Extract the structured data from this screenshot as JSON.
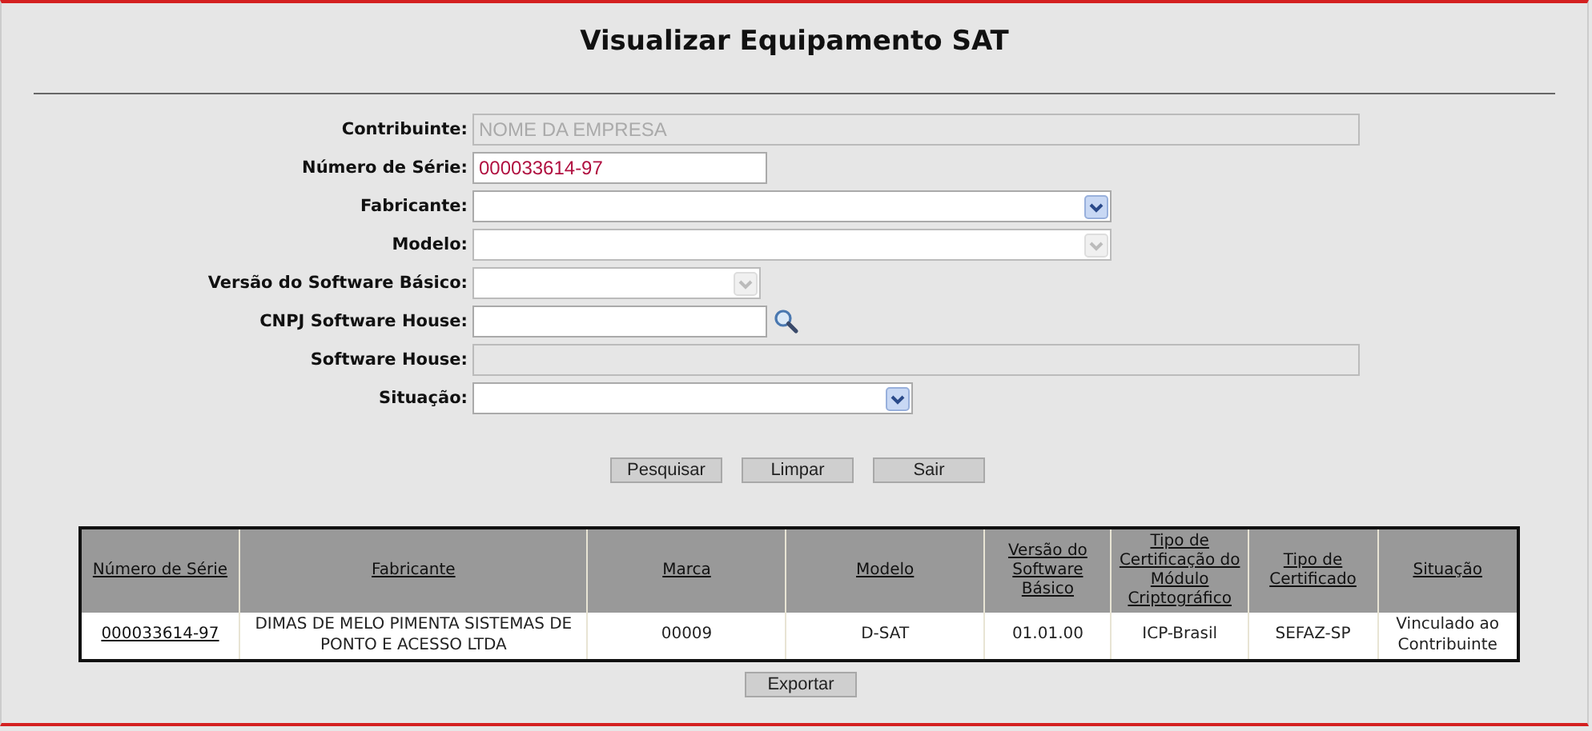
{
  "title": "Visualizar Equipamento SAT",
  "form": [
    {
      "label": "Contribuinte:",
      "kind": "text",
      "value": "NOME DA EMPRESA",
      "disabled": true
    },
    {
      "label": "Número de Série:",
      "kind": "text",
      "value": "000033614-97",
      "disabled": false
    },
    {
      "label": "Fabricante:",
      "kind": "select",
      "disabled": false
    },
    {
      "label": "Modelo:",
      "kind": "select",
      "disabled": true
    },
    {
      "label": "Versão do Software Básico:",
      "kind": "select",
      "disabled": true
    },
    {
      "label": "CNPJ Software House:",
      "kind": "search",
      "disabled": false
    },
    {
      "label": "Software House:",
      "kind": "text",
      "disabled": true
    },
    {
      "label": "Situação:",
      "kind": "select",
      "disabled": false
    }
  ],
  "buttons": [
    "Pesquisar",
    "Limpar",
    "Sair"
  ],
  "table": {
    "columns": [
      "Número de Série",
      "Fabricante",
      "Marca",
      "Modelo",
      "Versão do Software Básico",
      "Tipo de Certificação do Módulo Criptográfico",
      "Tipo de Certificado",
      "Situação"
    ],
    "rows": [
      {
        "cells": [
          "000033614-97",
          "DIMAS DE MELO PIMENTA SISTEMAS DE PONTO E ACESSO LTDA",
          "00009",
          "D-SAT",
          "01.01.00",
          "ICP-Brasil",
          "SEFAZ-SP",
          "Vinculado ao Contribuinte"
        ]
      }
    ]
  },
  "export_button": "Exportar"
}
